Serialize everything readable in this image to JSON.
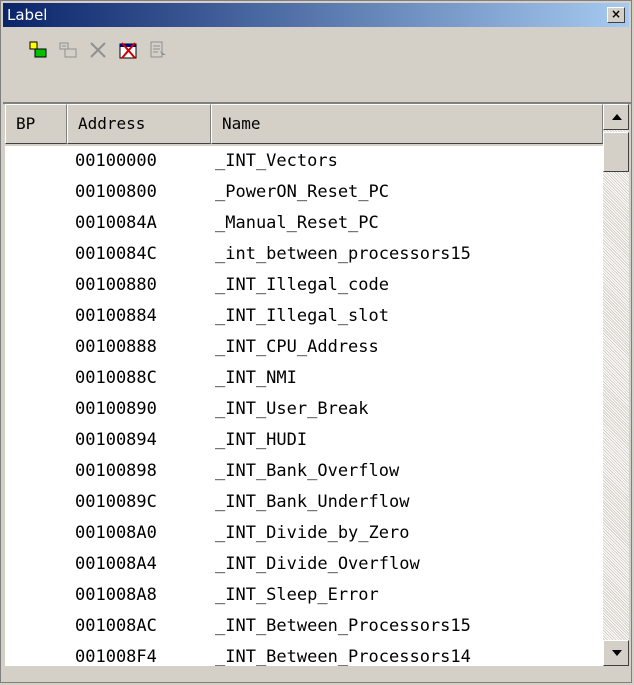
{
  "window": {
    "title": "Label",
    "close_symbol": "×"
  },
  "toolbar": {
    "buttons": [
      {
        "icon": "add-label-icon",
        "enabled": true
      },
      {
        "icon": "edit-label-icon",
        "enabled": false
      },
      {
        "icon": "delete-icon",
        "enabled": false
      },
      {
        "icon": "delete-all-icon",
        "enabled": true
      },
      {
        "icon": "list-properties-icon",
        "enabled": false
      }
    ]
  },
  "table": {
    "columns": [
      "BP",
      "Address",
      "Name"
    ],
    "rows": [
      {
        "bp": "",
        "address": "00100000",
        "name": "_INT_Vectors"
      },
      {
        "bp": "",
        "address": "00100800",
        "name": "_PowerON_Reset_PC"
      },
      {
        "bp": "",
        "address": "0010084A",
        "name": "_Manual_Reset_PC"
      },
      {
        "bp": "",
        "address": "0010084C",
        "name": "_int_between_processors15"
      },
      {
        "bp": "",
        "address": "00100880",
        "name": "_INT_Illegal_code"
      },
      {
        "bp": "",
        "address": "00100884",
        "name": "_INT_Illegal_slot"
      },
      {
        "bp": "",
        "address": "00100888",
        "name": "_INT_CPU_Address"
      },
      {
        "bp": "",
        "address": "0010088C",
        "name": "_INT_NMI"
      },
      {
        "bp": "",
        "address": "00100890",
        "name": "_INT_User_Break"
      },
      {
        "bp": "",
        "address": "00100894",
        "name": "_INT_HUDI"
      },
      {
        "bp": "",
        "address": "00100898",
        "name": "_INT_Bank_Overflow"
      },
      {
        "bp": "",
        "address": "0010089C",
        "name": "_INT_Bank_Underflow"
      },
      {
        "bp": "",
        "address": "001008A0",
        "name": "_INT_Divide_by_Zero"
      },
      {
        "bp": "",
        "address": "001008A4",
        "name": "_INT_Divide_Overflow"
      },
      {
        "bp": "",
        "address": "001008A8",
        "name": "_INT_Sleep_Error"
      },
      {
        "bp": "",
        "address": "001008AC",
        "name": "_INT_Between_Processors15"
      },
      {
        "bp": "",
        "address": "001008F4",
        "name": "_INT_Between_Processors14"
      }
    ]
  }
}
